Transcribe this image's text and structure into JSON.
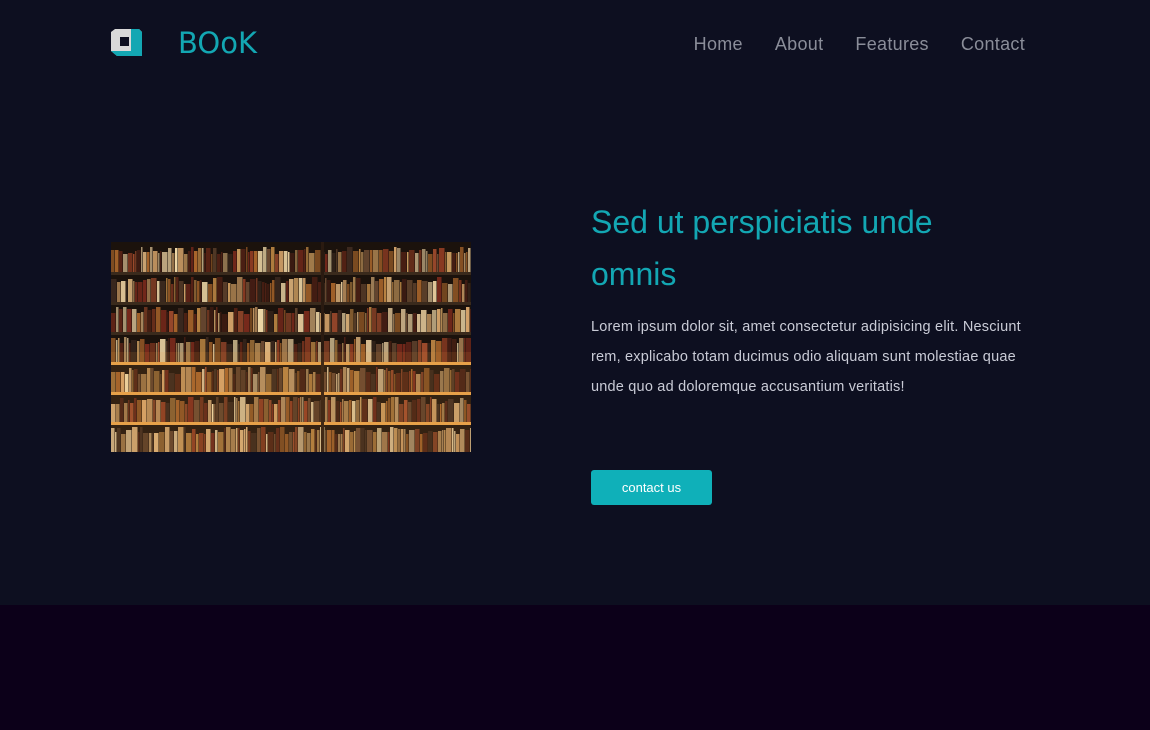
{
  "brand": {
    "name": "BOoK",
    "logo_icon": "book-logo-icon",
    "accent_color": "#13a7b3"
  },
  "nav": {
    "items": [
      {
        "label": "Home"
      },
      {
        "label": "About"
      },
      {
        "label": "Features"
      },
      {
        "label": "Contact"
      }
    ]
  },
  "hero": {
    "title": "Sed ut perspiciatis unde omnis",
    "text": "Lorem ipsum dolor sit, amet consectetur adipisicing elit. Nesciunt rem, explicabo totam ducimus odio aliquam sunt molestiae quae unde quo ad doloremque accusantium veritatis!",
    "button_label": "contact us",
    "image": "bookshelf-photo",
    "button_color": "#0fb0b9"
  },
  "colors": {
    "background": "#0d0f20",
    "footer": "#0c0019"
  }
}
